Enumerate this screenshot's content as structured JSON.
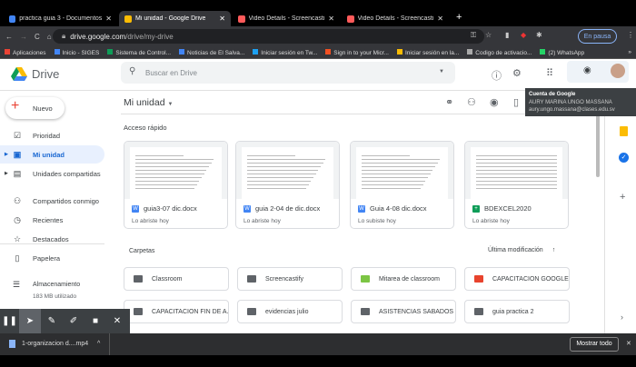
{
  "browser": {
    "tabs": [
      {
        "label": "practica guia 3 - Documentos de",
        "active": false,
        "color": "#4285f4"
      },
      {
        "label": "Mi unidad - Google Drive",
        "active": true,
        "color": "#fbbc04"
      },
      {
        "label": "Video Details - Screencastify",
        "active": false,
        "color": "#ff5a5a"
      },
      {
        "label": "Video Details - Screencastify",
        "active": false,
        "color": "#ff5a5a"
      }
    ],
    "url_host": "drive.google.com",
    "url_path": "/drive/my-drive",
    "profile_status": "En pausa",
    "bookmarks": [
      "Aplicaciones",
      "Inicio - SIGES",
      "Sistema de Control...",
      "Noticias de El Salva...",
      "Iniciar sesión en Tw...",
      "Sign in to your Micr...",
      "Iniciar sesión en la...",
      "Codigo de activacio...",
      "(2) WhatsApp"
    ]
  },
  "drive": {
    "logo": "Drive",
    "search_placeholder": "Buscar en Drive",
    "new_button": "Nuevo",
    "sidebar": [
      {
        "label": "Prioridad",
        "icon": "priority-icon"
      },
      {
        "label": "Mi unidad",
        "icon": "my-drive-icon",
        "active": true
      },
      {
        "label": "Unidades compartidas",
        "icon": "shared-drives-icon"
      },
      {
        "label": "Compartidos conmigo",
        "icon": "shared-with-me-icon"
      },
      {
        "label": "Recientes",
        "icon": "recent-icon"
      },
      {
        "label": "Destacados",
        "icon": "star-icon"
      },
      {
        "label": "Papelera",
        "icon": "trash-icon"
      }
    ],
    "storage": {
      "label": "Almacenamiento",
      "used": "183 MB utilizado"
    },
    "title": "Mi unidad",
    "quick_access_label": "Acceso rápido",
    "quick_access": [
      {
        "name": "guia3-07 dic.docx",
        "sub": "Lo abriste hoy",
        "type": "word"
      },
      {
        "name": "guia 2-04 de dic.docx",
        "sub": "Lo abriste hoy",
        "type": "word"
      },
      {
        "name": "Guia 4-08 dic.docx",
        "sub": "Lo subiste hoy",
        "type": "word"
      },
      {
        "name": "BDEXCEL2020",
        "sub": "Lo abriste hoy",
        "type": "sheets"
      }
    ],
    "folders_label": "Carpetas",
    "sort_label": "Última modificación",
    "folders": [
      {
        "name": "Classroom",
        "color": "#5f6368"
      },
      {
        "name": "Screencastify",
        "color": "#5f6368"
      },
      {
        "name": "Mitarea de classroom",
        "color": "#7cc544"
      },
      {
        "name": "CAPACITACION GOOGLE ...",
        "color": "#e8432d"
      },
      {
        "name": "CAPACITACION FIN DE A...",
        "color": "#5f6368"
      },
      {
        "name": "evidencias julio",
        "color": "#5f6368"
      },
      {
        "name": "ASISTENCIAS SABADOS ...",
        "color": "#5f6368"
      },
      {
        "name": "guia practica 2",
        "color": "#5f6368"
      }
    ],
    "tooltip": {
      "title": "Cuenta de Google",
      "name": "AURY MARINA UNGO MASSANA",
      "email": "aury.ungo.massana@clases.edu.sv"
    }
  },
  "download": {
    "file": "1-organizacion d....mp4",
    "show_all": "Mostrar todo"
  }
}
